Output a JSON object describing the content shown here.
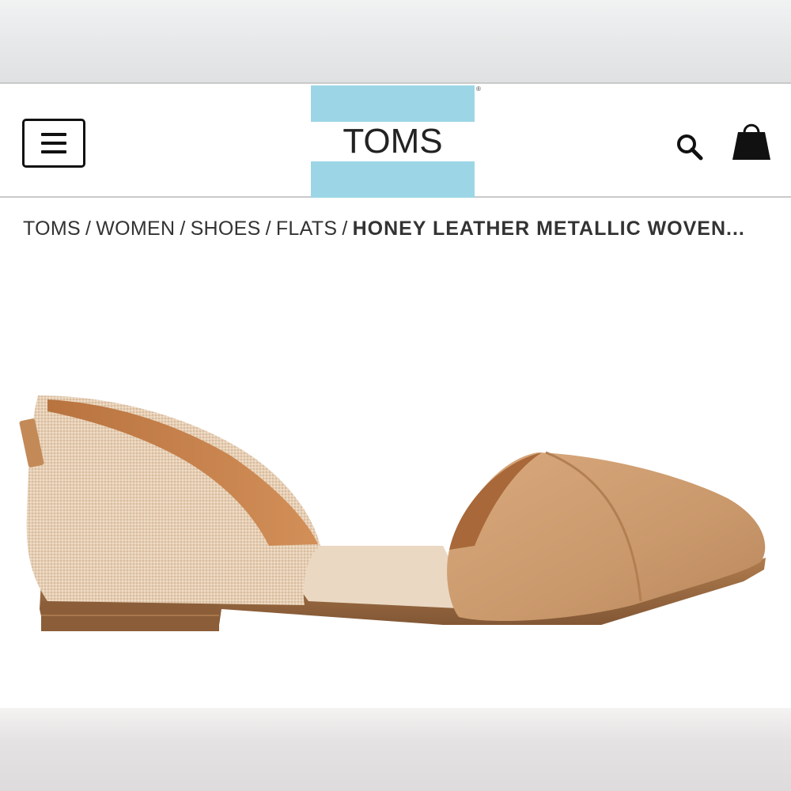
{
  "header": {
    "logo_text": "TOMS",
    "logo_registered": "®",
    "icons": {
      "menu": "hamburger-menu-icon",
      "search": "search-icon",
      "bag": "shopping-bag-icon"
    },
    "colors": {
      "logo_stripe": "#9cd6e6",
      "border": "#c9c9c9"
    }
  },
  "breadcrumb": {
    "items": [
      "TOMS",
      "WOMEN",
      "SHOES",
      "FLATS"
    ],
    "separator": "/",
    "current": "HONEY LEATHER METALLIC WOVEN..."
  },
  "product": {
    "image_name": "honey-leather-dorsay-flat"
  }
}
